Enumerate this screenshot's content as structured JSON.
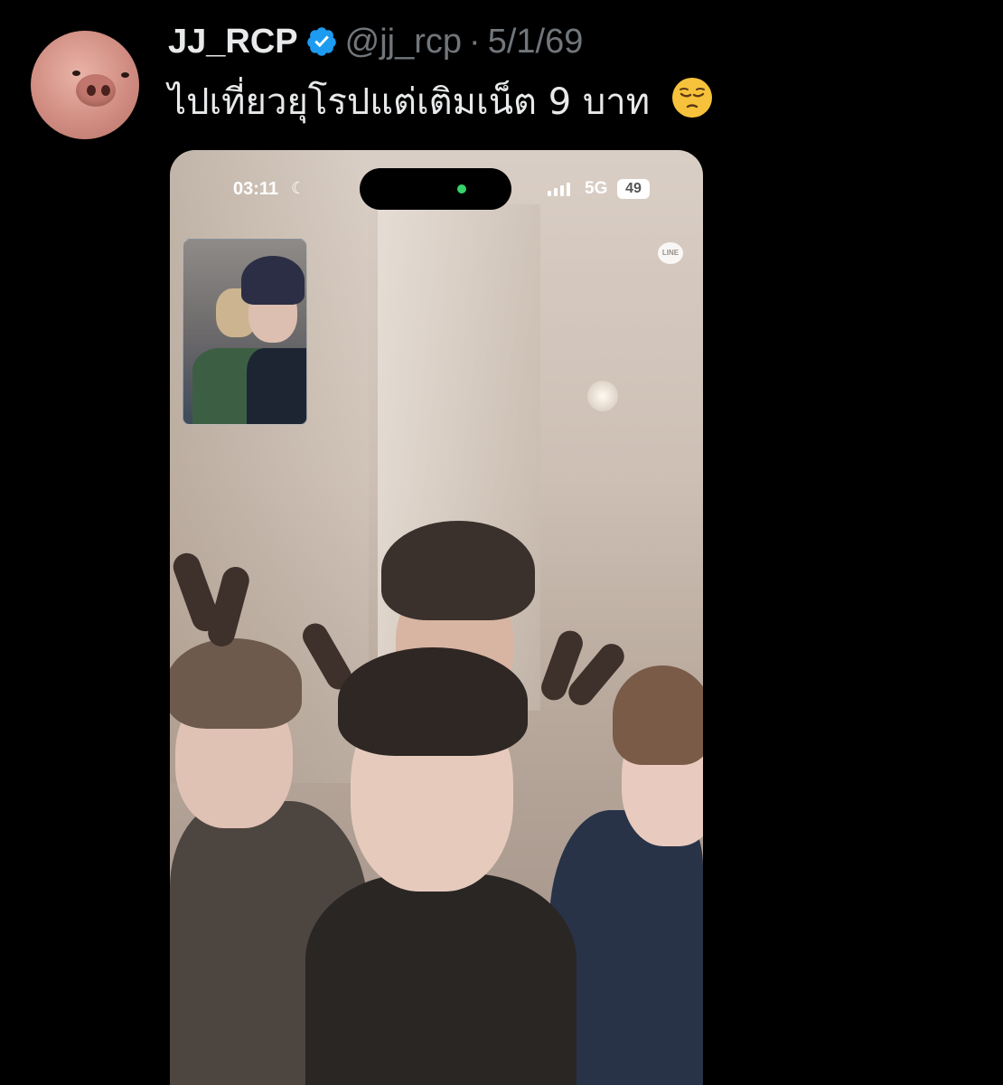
{
  "tweet": {
    "display_name": "JJ_RCP",
    "handle": "@jj_rcp",
    "separator": "·",
    "date": "5/1/69",
    "text": "ไปเที่ยวยุโรปแต่เติมเน็ต 9 บาท",
    "emoji": "pensive-face"
  },
  "media": {
    "status_bar": {
      "time": "03:11",
      "network": "5G",
      "battery": "49"
    },
    "app_badge": "LINE"
  },
  "colors": {
    "background": "#000000",
    "text_primary": "#e7e9ea",
    "text_secondary": "#71767b",
    "verified_blue": "#1d9bf0"
  }
}
